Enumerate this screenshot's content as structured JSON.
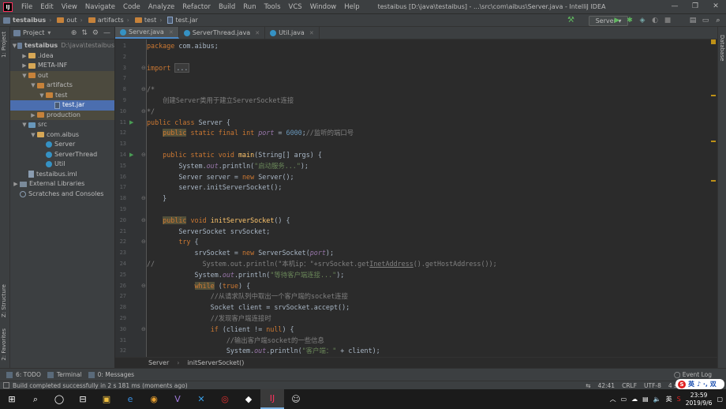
{
  "app": {
    "logo": "IJ",
    "menu": [
      "File",
      "Edit",
      "View",
      "Navigate",
      "Code",
      "Analyze",
      "Refactor",
      "Build",
      "Run",
      "Tools",
      "VCS",
      "Window",
      "Help"
    ],
    "window_title": "testaibus [D:\\java\\testaibus] - ...\\src\\com\\aibus\\Server.java - IntelliJ IDEA",
    "window_controls": [
      "—",
      "❐",
      "✕"
    ]
  },
  "navbar": {
    "crumbs": [
      "testaibus",
      "out",
      "artifacts",
      "test",
      "test.jar"
    ],
    "run_config": "Server ▾"
  },
  "project_panel": {
    "title": "Project",
    "dropdown": "▾",
    "tree": [
      {
        "label": "testaibus",
        "extra": "D:\\java\\testaibus",
        "depth": 0,
        "arrow": "▼",
        "icon": "module",
        "style": "bold"
      },
      {
        "label": ".idea",
        "depth": 1,
        "arrow": "▶",
        "icon": "folder"
      },
      {
        "label": "META-INF",
        "depth": 1,
        "arrow": "▶",
        "icon": "folder"
      },
      {
        "label": "out",
        "depth": 1,
        "arrow": "▼",
        "icon": "folder-orange",
        "style": "out"
      },
      {
        "label": "artifacts",
        "depth": 2,
        "arrow": "▼",
        "icon": "folder-orange",
        "style": "out"
      },
      {
        "label": "test",
        "depth": 3,
        "arrow": "▼",
        "icon": "folder-orange",
        "style": "out"
      },
      {
        "label": "test.jar",
        "depth": 4,
        "arrow": "",
        "icon": "jar",
        "style": "sel"
      },
      {
        "label": "production",
        "depth": 2,
        "arrow": "▶",
        "icon": "folder-orange",
        "style": "out"
      },
      {
        "label": "src",
        "depth": 1,
        "arrow": "▼",
        "icon": "folder-blue"
      },
      {
        "label": "com.aibus",
        "depth": 2,
        "arrow": "▼",
        "icon": "folder"
      },
      {
        "label": "Server",
        "depth": 3,
        "arrow": "",
        "icon": "class"
      },
      {
        "label": "ServerThread",
        "depth": 3,
        "arrow": "",
        "icon": "class"
      },
      {
        "label": "Util",
        "depth": 3,
        "arrow": "",
        "icon": "class"
      },
      {
        "label": "testaibus.iml",
        "depth": 1,
        "arrow": "",
        "icon": "iml"
      },
      {
        "label": "External Libraries",
        "depth": 0,
        "arrow": "▶",
        "icon": "lib"
      },
      {
        "label": "Scratches and Consoles",
        "depth": 0,
        "arrow": "",
        "icon": "scratch"
      }
    ]
  },
  "side_labels": {
    "project": "1: Project",
    "structure": "Z: Structure",
    "favorites": "2: Favorites",
    "database": "Database"
  },
  "tabs": [
    {
      "label": "Server.java",
      "active": true
    },
    {
      "label": "ServerThread.java",
      "active": false
    },
    {
      "label": "Util.java",
      "active": false
    }
  ],
  "editor": {
    "lines": [
      {
        "n": 1,
        "html": "<span class='kw'>package</span> com.aibus;"
      },
      {
        "n": 2,
        "html": ""
      },
      {
        "n": 3,
        "html": "<span class='kw'>import</span> <span class='fold-dots'>...</span>"
      },
      {
        "n": 7,
        "html": ""
      },
      {
        "n": 8,
        "html": "<span class='cmt'>/*</span>"
      },
      {
        "n": 9,
        "html": "<span class='cmt'>    创建Server类用于建立ServerSocket连接</span>"
      },
      {
        "n": 10,
        "html": "<span class='cmt'>*/</span>"
      },
      {
        "n": 11,
        "html": "<span class='kw'>public class</span> Server {"
      },
      {
        "n": 12,
        "html": "    <span class='kwbox'>public</span> <span class='kw'>static final int</span> <span class='fld'>port</span> = <span class='num'>6000</span>;<span class='cmt'>//监听的端口号</span>"
      },
      {
        "n": 13,
        "html": ""
      },
      {
        "n": 14,
        "html": "    <span class='kw'>public static void</span> <span class='fn'>main</span>(String[] args) {"
      },
      {
        "n": 15,
        "html": "        System.<span class='fld'>out</span>.println(<span class='str'>\"启动服务...\"</span>);"
      },
      {
        "n": 16,
        "html": "        Server server = <span class='kw'>new</span> Server();"
      },
      {
        "n": 17,
        "html": "        server.initServerSocket();"
      },
      {
        "n": 18,
        "html": "    }"
      },
      {
        "n": 19,
        "html": ""
      },
      {
        "n": 20,
        "html": "    <span class='kwbox'>public</span> <span class='kw'>void</span> <span class='fn'>initServerSocket</span>() {"
      },
      {
        "n": 21,
        "html": "        ServerSocket srvSocket;"
      },
      {
        "n": 22,
        "html": "        <span class='kw'>try</span> {"
      },
      {
        "n": 23,
        "html": "            srvSocket = <span class='kw'>new</span> ServerSocket(<span class='fld'>port</span>);"
      },
      {
        "n": 24,
        "html": "<span class='cmt'>//            System.out.println(\"本机ip：\"+srvSocket.get<span class='und'>InetAddress</span>().getHostAddress());</span>"
      },
      {
        "n": 25,
        "html": "            System.<span class='fld'>out</span>.println(<span class='str'>\"等待客户端连接...\"</span>);"
      },
      {
        "n": 26,
        "html": "            <span class='kwbox'>while</span> (<span class='kw'>true</span>) {"
      },
      {
        "n": 27,
        "html": "                <span class='cmt'>//从请求队列中取出一个客户端的socket连接</span>"
      },
      {
        "n": 28,
        "html": "                Socket client = srvSocket.accept();"
      },
      {
        "n": 29,
        "html": "                <span class='cmt'>//发现客户端连接时</span>"
      },
      {
        "n": 30,
        "html": "                <span class='kw'>if</span> (client != <span class='kw'>null</span>) {"
      },
      {
        "n": 31,
        "html": "                    <span class='cmt'>//输出客户端socket的一些信息</span>"
      },
      {
        "n": 32,
        "html": "                    System.<span class='fld'>out</span>.println(<span class='str'>\"客户端：\"</span> + client);"
      }
    ],
    "run_markers": [
      11,
      14
    ],
    "fold_markers": [
      3,
      8,
      10,
      14,
      18,
      20,
      22,
      26,
      30
    ]
  },
  "editor_breadcrumb": [
    "Server",
    "initServerSocket()"
  ],
  "bottom_tabs": [
    {
      "label": "6: TODO",
      "icon": "todo-icon"
    },
    {
      "label": "Terminal",
      "icon": "terminal-icon"
    },
    {
      "label": "0: Messages",
      "icon": "messages-icon"
    }
  ],
  "event_log": "Event Log",
  "status": {
    "message": "Build completed successfully in 2 s 181 ms (moments ago)",
    "position": "42:41",
    "line_sep": "CRLF",
    "encoding": "UTF-8",
    "indent": "4 s"
  },
  "ime": {
    "label": "英",
    "icons": "♪ ·,  双"
  },
  "taskbar": {
    "time": "23:59",
    "date": "2019/9/6",
    "lang": "英",
    "apps": [
      "⊞",
      "⌕",
      "◯",
      "⊟",
      "▣",
      "e",
      "◉",
      "V",
      "✕",
      "◎",
      "◆",
      "IJ",
      "☺"
    ]
  },
  "colors": {
    "accent": "#4a88c7",
    "selection": "#4b6eaf",
    "keyword": "#cc7832",
    "string": "#6a8759"
  }
}
